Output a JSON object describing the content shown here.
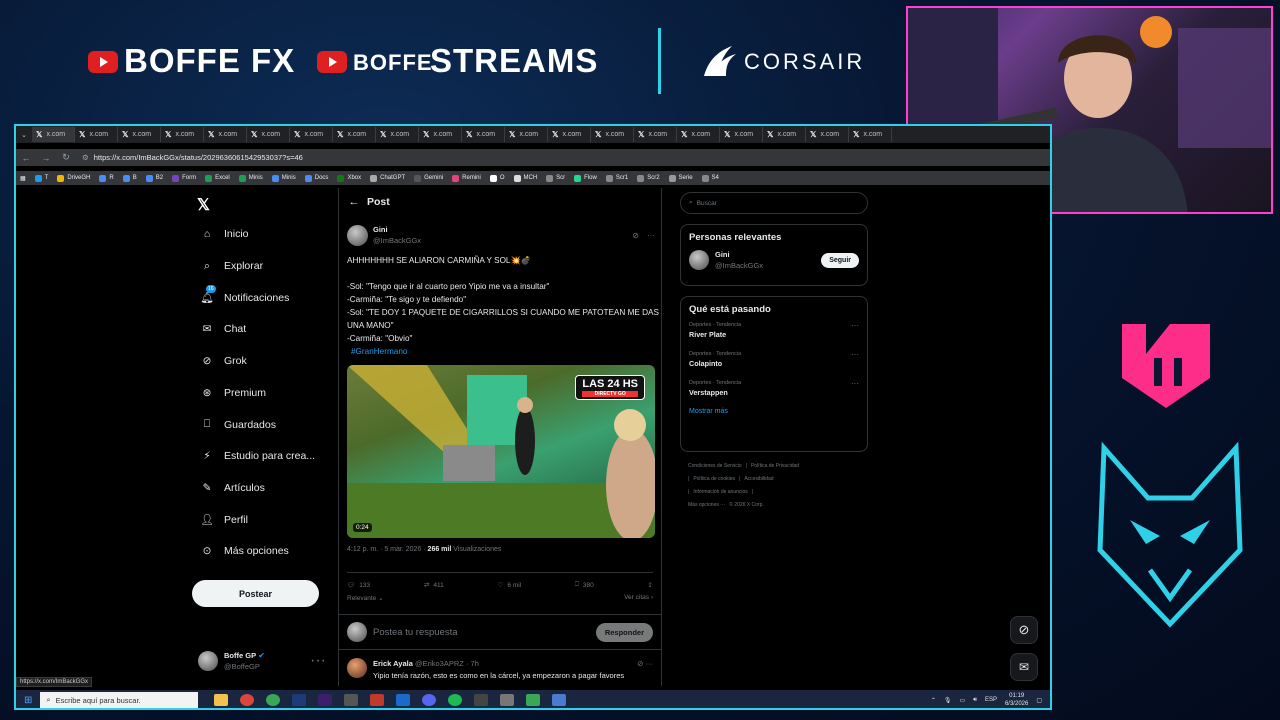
{
  "overlay": {
    "brand1": "BOFFE FX",
    "brand2_small": "BOFFE",
    "brand2_big": "STREAMS",
    "sponsor": "CORSAIR"
  },
  "browser": {
    "tab_label": "x.com",
    "tab_count": 20,
    "url": "https://x.com/ImBackGGx/status/2029636061542953037?s=46",
    "bookmarks": [
      {
        "label": "T",
        "color": "#1d9bf0"
      },
      {
        "label": "DriveGH",
        "color": "#f4b400"
      },
      {
        "label": "R",
        "color": "#4b8bf5"
      },
      {
        "label": "B",
        "color": "#4b8bf5"
      },
      {
        "label": "B2",
        "color": "#4b8bf5"
      },
      {
        "label": "Form",
        "color": "#7248b9"
      },
      {
        "label": "Excel",
        "color": "#1f9d55"
      },
      {
        "label": "Minis",
        "color": "#1f9d55"
      },
      {
        "label": "Minis",
        "color": "#4b8bf5"
      },
      {
        "label": "Docs",
        "color": "#4b8bf5"
      },
      {
        "label": "Xbox",
        "color": "#107c10"
      },
      {
        "label": "ChatGPT",
        "color": "#aaaaaa"
      },
      {
        "label": "Gemini",
        "color": "#555555"
      },
      {
        "label": "Remini",
        "color": "#e0457b"
      },
      {
        "label": "O",
        "color": "#ffffff"
      },
      {
        "label": "MCH",
        "color": "#dddddd"
      },
      {
        "label": "Scr",
        "color": "#888888"
      },
      {
        "label": "Flow",
        "color": "#2bd48f"
      },
      {
        "label": "Scr1",
        "color": "#888888"
      },
      {
        "label": "Scr2",
        "color": "#888888"
      },
      {
        "label": "Serie",
        "color": "#999999"
      },
      {
        "label": "S4",
        "color": "#888888"
      }
    ],
    "status_url": "https://x.com/ImBackGGx"
  },
  "nav": {
    "items": [
      {
        "label": "Inicio",
        "icon": "home-icon"
      },
      {
        "label": "Explorar",
        "icon": "search-icon"
      },
      {
        "label": "Notificaciones",
        "icon": "bell-icon",
        "badge": "16"
      },
      {
        "label": "Chat",
        "icon": "mail-icon"
      },
      {
        "label": "Grok",
        "icon": "grok-icon"
      },
      {
        "label": "Premium",
        "icon": "premium-icon"
      },
      {
        "label": "Guardados",
        "icon": "bookmark-icon"
      },
      {
        "label": "Estudio para crea...",
        "icon": "studio-icon"
      },
      {
        "label": "Artículos",
        "icon": "article-icon"
      },
      {
        "label": "Perfil",
        "icon": "person-icon"
      },
      {
        "label": "Más opciones",
        "icon": "more-circle-icon"
      }
    ],
    "post_button": "Postear",
    "user": {
      "name": "Boffe GP",
      "handle": "@BoffeGP"
    }
  },
  "post": {
    "header": "Post",
    "author": {
      "name": "Gini",
      "handle": "@ImBackGGx"
    },
    "lines": [
      "AHHHHHHH SE ALIARON CARMIÑA Y SOL💥💣",
      "",
      "-Sol: \"Tengo que ir al cuarto pero Yipio me va a insultar\"",
      "-Carmiña: \"Te sigo y te defiendo\"",
      "-Sol: \"TE DOY 1 PAQUETE DE CIGARRILLOS SI CUANDO ME PATOTEAN ME DAS UNA MANO\"",
      "-Carmiña: \"Obvio\""
    ],
    "hashtag": "#GranHermano",
    "video_duration": "0:24",
    "tv_badge": "LAS 24 HS",
    "tv_sub": "DIRECTV GO",
    "time": "4:12 p. m. · 5 mar. 2026 · ",
    "views": "266 mil",
    "views_label": " Visualizaciones",
    "stats": {
      "replies": "133",
      "reposts": "411",
      "likes": "6 mil",
      "bookmarks": "380"
    },
    "sort": "Relevante",
    "quotes": "Ver citas",
    "reply_placeholder": "Postea tu respuesta",
    "reply_button": "Responder"
  },
  "reply": {
    "name": "Erick Ayala",
    "handle": "@Eriko3APRZ · 7h",
    "text": "Yipio tenía razón, esto es como en la cárcel, ya empezaron a pagar favores"
  },
  "sidebar": {
    "search_placeholder": "Buscar",
    "relevant_title": "Personas relevantes",
    "relevant": {
      "name": "Gini",
      "handle": "@ImBackGGx",
      "button": "Seguir"
    },
    "trends_title": "Qué está pasando",
    "trends": [
      {
        "context": "Deportes · Tendencia",
        "name": "River Plate"
      },
      {
        "context": "Deportes · Tendencia",
        "name": "Colapinto"
      },
      {
        "context": "Deportes · Tendencia",
        "name": "Verstappen"
      }
    ],
    "show_more": "Mostrar más",
    "footer": [
      "Condiciones de Servicio",
      "|",
      "Política de Privacidad",
      "|",
      "Política de cookies",
      "|",
      "Accesibilidad",
      "|",
      "Información de anuncios",
      "|",
      "Más opciones ···",
      "© 2026 X Corp."
    ]
  },
  "taskbar": {
    "search": "Escribe aquí para buscar.",
    "lang": "ESP",
    "time": "01:19",
    "date": "6/3/2026"
  }
}
